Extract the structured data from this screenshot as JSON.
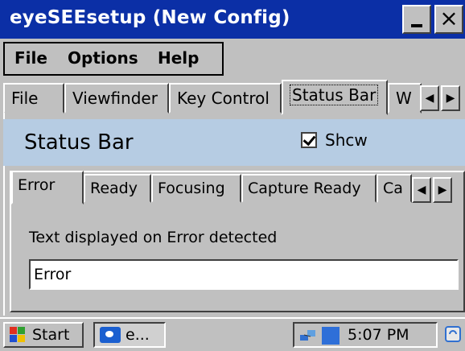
{
  "window": {
    "title": "eyeSEEsetup (New Config)",
    "minimize_label": "_",
    "close_label": "×"
  },
  "menubar": {
    "items": [
      "File",
      "Options",
      "Help"
    ]
  },
  "outer_tabs": {
    "items": [
      "File",
      "Viewfinder",
      "Key Control",
      "Status Bar",
      "W"
    ],
    "selected": "Status Bar"
  },
  "section": {
    "title": "Status Bar",
    "show_label": "Shcw",
    "show_checked": true
  },
  "inner_tabs": {
    "items": [
      "Error",
      "Ready",
      "Focusing",
      "Capture Ready",
      "Ca"
    ],
    "selected": "Error"
  },
  "content": {
    "description": "Text displayed on Error detected",
    "value": "Error"
  },
  "taskbar": {
    "start_label": "Start",
    "task_label": "e...",
    "clock": "5:07 PM"
  },
  "icons": {
    "scroll_left": "◀",
    "scroll_right": "▶"
  },
  "colors": {
    "titlebar": "#0b2fa6",
    "header_band": "#b6cce3",
    "face": "#c0c0c0"
  }
}
